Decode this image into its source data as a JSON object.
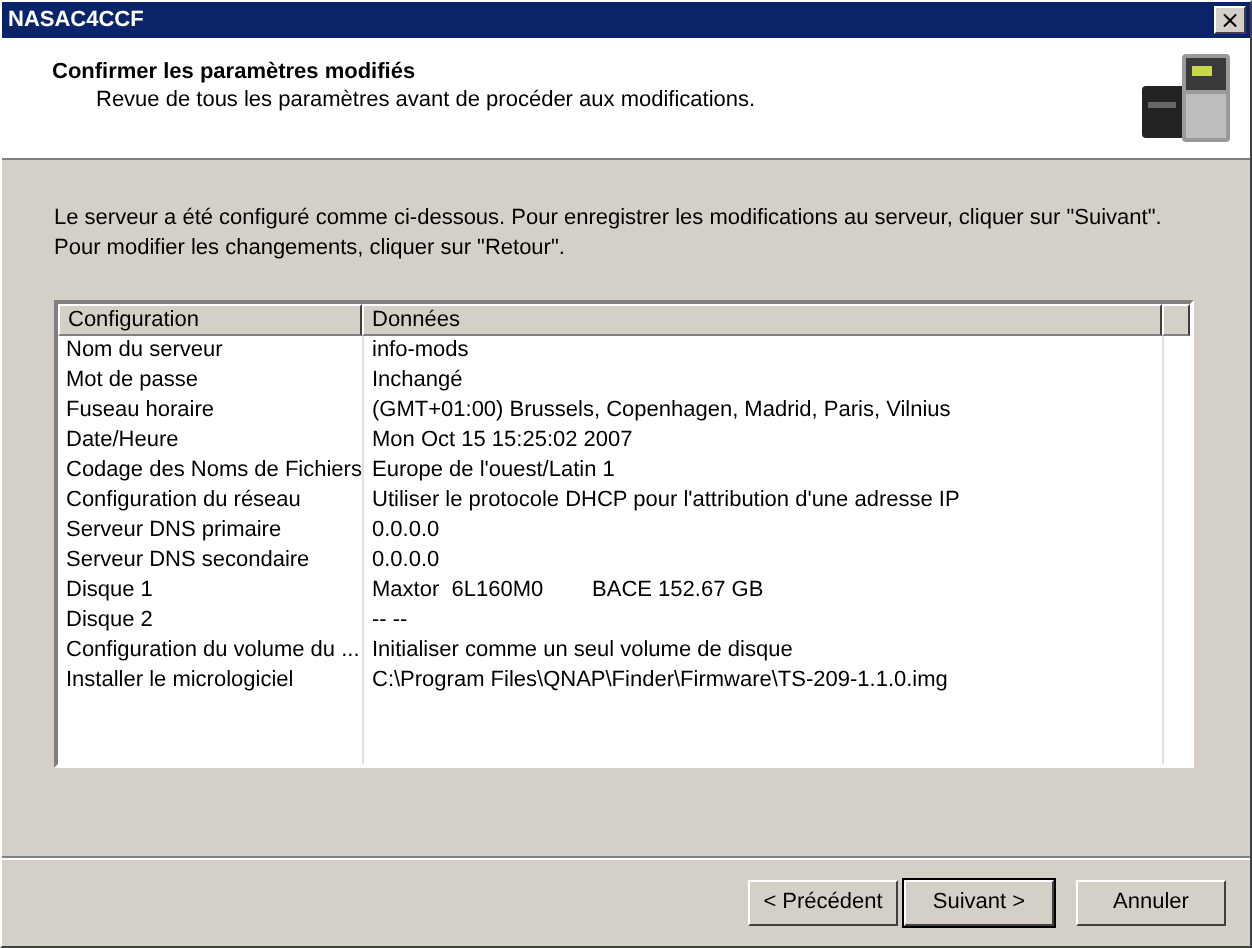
{
  "window": {
    "title": "NASAC4CCF",
    "close": "×"
  },
  "header": {
    "title": "Confirmer les paramètres modifiés",
    "subtitle": "Revue de tous les paramètres avant de procéder aux modifications."
  },
  "intro": "Le serveur a été configuré comme ci-dessous. Pour enregistrer les modifications au serveur, cliquer sur \"Suivant\". Pour modifier les changements, cliquer sur \"Retour\".",
  "table": {
    "columns": [
      "Configuration",
      "Données"
    ],
    "rows": [
      [
        "Nom du serveur",
        "info-mods"
      ],
      [
        "Mot de passe",
        "Inchangé"
      ],
      [
        "Fuseau horaire",
        "(GMT+01:00) Brussels, Copenhagen, Madrid, Paris, Vilnius"
      ],
      [
        "Date/Heure",
        "Mon Oct 15 15:25:02 2007"
      ],
      [
        "Codage des Noms de Fichiers",
        "Europe de l'ouest/Latin 1"
      ],
      [
        "Configuration du réseau",
        "Utiliser le protocole DHCP pour l'attribution d'une adresse IP"
      ],
      [
        "Serveur DNS primaire",
        "0.0.0.0"
      ],
      [
        "Serveur DNS secondaire",
        "0.0.0.0"
      ],
      [
        "Disque 1",
        "Maxtor  6L160M0        BACE 152.67 GB"
      ],
      [
        "Disque 2",
        "-- --"
      ],
      [
        "Configuration du volume du ...",
        "Initialiser comme un seul volume de disque"
      ],
      [
        "Installer le micrologiciel",
        "C:\\Program Files\\QNAP\\Finder\\Firmware\\TS-209-1.1.0.img"
      ]
    ]
  },
  "buttons": [
    {
      "label": "< Précédent",
      "default": false
    },
    {
      "label": "Suivant >",
      "default": true
    },
    {
      "label": "Annuler",
      "default": false
    }
  ]
}
